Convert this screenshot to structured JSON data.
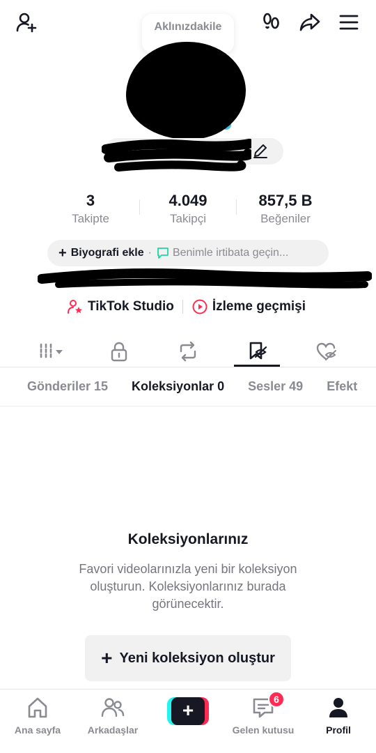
{
  "header": {
    "add_friend_icon": "person-add-icon",
    "footprints_icon": "footprints-icon",
    "share_icon": "share-icon",
    "menu_icon": "menu-icon",
    "thought_bubble": "Aklınızdakile"
  },
  "stats": {
    "following_count": "3",
    "following_label": "Takipte",
    "followers_count": "4.049",
    "followers_label": "Takipçi",
    "likes_count": "857,5 B",
    "likes_label": "Beğeniler"
  },
  "bio": {
    "add_label": "Biyografi ekle",
    "separator": "·",
    "contact_label": "Benimle irtibata geçin..."
  },
  "links": {
    "studio_label": "TikTok Studio",
    "history_label": "İzleme geçmişi"
  },
  "content_tabs": [
    "videos-grid-icon",
    "lock-icon",
    "repost-icon",
    "favorites-icon",
    "liked-icon"
  ],
  "subtabs": [
    {
      "label": "Gönderiler 15"
    },
    {
      "label": "Koleksiyonlar 0"
    },
    {
      "label": "Sesler 49"
    },
    {
      "label": "Efekt"
    }
  ],
  "empty_state": {
    "title": "Koleksiyonlarınız",
    "description": "Favori videolarınızla yeni bir koleksiyon oluşturun. Koleksiyonlarınız burada görünecektir.",
    "button_label": "Yeni koleksiyon oluştur"
  },
  "bottom_nav": {
    "home": "Ana sayfa",
    "friends": "Arkadaşlar",
    "inbox": "Gelen kutusu",
    "inbox_badge": "6",
    "profile": "Profil",
    "post_symbol": "+"
  },
  "colors": {
    "primary_text": "#161823",
    "secondary_text": "#8a8b91",
    "accent_red": "#fe2c55",
    "accent_cyan": "#25f4ee",
    "studio_pink": "#fe2c55",
    "contact_green": "#20d5a5"
  }
}
